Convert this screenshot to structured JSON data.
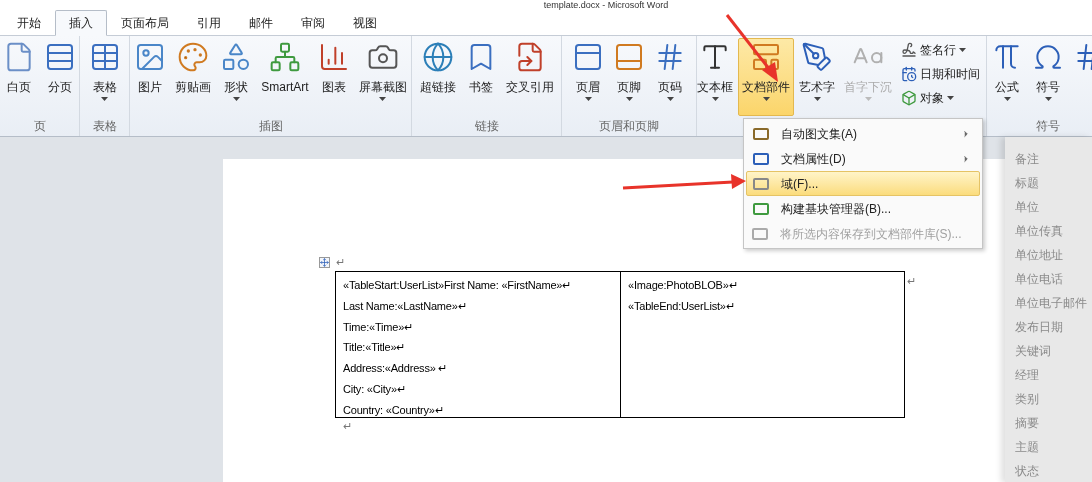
{
  "window": {
    "title": "template.docx - Microsoft Word"
  },
  "tabs": [
    {
      "label": "开始",
      "selected": false
    },
    {
      "label": "插入",
      "selected": true
    },
    {
      "label": "页面布局",
      "selected": false
    },
    {
      "label": "引用",
      "selected": false
    },
    {
      "label": "邮件",
      "selected": false
    },
    {
      "label": "审阅",
      "selected": false
    },
    {
      "label": "视图",
      "selected": false
    }
  ],
  "ribbon_groups": [
    {
      "label": "页",
      "items": [
        {
          "label": "白页",
          "kind": "large",
          "dropdown": false,
          "highlighted": false,
          "disabled": false
        },
        {
          "label": "分页",
          "kind": "large",
          "dropdown": false,
          "highlighted": false,
          "disabled": false
        }
      ]
    },
    {
      "label": "表格",
      "items": [
        {
          "label": "表格",
          "kind": "large",
          "dropdown": true,
          "highlighted": false,
          "disabled": false
        }
      ]
    },
    {
      "label": "插图",
      "items": [
        {
          "label": "图片",
          "kind": "large",
          "dropdown": false,
          "highlighted": false,
          "disabled": false
        },
        {
          "label": "剪贴画",
          "kind": "large",
          "dropdown": false,
          "highlighted": false,
          "disabled": false
        },
        {
          "label": "形状",
          "kind": "large",
          "dropdown": true,
          "highlighted": false,
          "disabled": false
        },
        {
          "label": "SmartArt",
          "kind": "large",
          "dropdown": false,
          "highlighted": false,
          "disabled": false
        },
        {
          "label": "图表",
          "kind": "large",
          "dropdown": false,
          "highlighted": false,
          "disabled": false
        },
        {
          "label": "屏幕截图",
          "kind": "large",
          "dropdown": true,
          "highlighted": false,
          "disabled": false
        }
      ]
    },
    {
      "label": "链接",
      "items": [
        {
          "label": "超链接",
          "kind": "large",
          "dropdown": false,
          "highlighted": false,
          "disabled": false
        },
        {
          "label": "书签",
          "kind": "large",
          "dropdown": false,
          "highlighted": false,
          "disabled": false
        },
        {
          "label": "交叉引用",
          "kind": "large",
          "dropdown": false,
          "highlighted": false,
          "disabled": false
        }
      ]
    },
    {
      "label": "页眉和页脚",
      "items": [
        {
          "label": "页眉",
          "kind": "large",
          "dropdown": true,
          "highlighted": false,
          "disabled": false
        },
        {
          "label": "页脚",
          "kind": "large",
          "dropdown": true,
          "highlighted": false,
          "disabled": false
        },
        {
          "label": "页码",
          "kind": "large",
          "dropdown": true,
          "highlighted": false,
          "disabled": false
        }
      ]
    },
    {
      "items": [
        {
          "label": "文本框",
          "kind": "large",
          "dropdown": true,
          "highlighted": false,
          "disabled": false
        },
        {
          "label": "文档部件",
          "kind": "large",
          "dropdown": true,
          "highlighted": true,
          "disabled": false
        },
        {
          "label": "艺术字",
          "kind": "large",
          "dropdown": true,
          "highlighted": false,
          "disabled": false
        },
        {
          "label": "首字下沉",
          "kind": "large",
          "dropdown": true,
          "highlighted": false,
          "disabled": true
        },
        {
          "label": "签名行",
          "kind": "small",
          "dropdown": true,
          "highlighted": false,
          "disabled": false
        },
        {
          "label": "日期和时间",
          "kind": "small",
          "dropdown": false,
          "highlighted": false,
          "disabled": false
        },
        {
          "label": "对象",
          "kind": "small",
          "dropdown": true,
          "highlighted": false,
          "disabled": false
        }
      ]
    },
    {
      "label": "符号",
      "items": [
        {
          "label": "公式",
          "kind": "large",
          "dropdown": true,
          "highlighted": false,
          "disabled": false
        },
        {
          "label": "符号",
          "kind": "large",
          "dropdown": true,
          "highlighted": false,
          "disabled": false
        },
        {
          "kind": "large",
          "dropdown": false,
          "highlighted": false,
          "disabled": false
        }
      ]
    }
  ],
  "menu": {
    "items": [
      {
        "label": "自动图文集(A)",
        "submenu": true,
        "selected": false,
        "disabled": false
      },
      {
        "label": "文档属性(D)",
        "submenu": true,
        "selected": false,
        "disabled": false
      },
      {
        "label": "域(F)...",
        "submenu": false,
        "selected": true,
        "disabled": false
      },
      {
        "label": "构建基块管理器(B)...",
        "submenu": false,
        "selected": false,
        "disabled": false
      },
      {
        "label": "将所选内容保存到文档部件库(S)...",
        "submenu": false,
        "selected": false,
        "disabled": true
      }
    ]
  },
  "document": {
    "before_mark": "↵",
    "row_end_mark": "↵",
    "after_mark": "↵",
    "cells": [
      {
        "lines": [
          "«TableStart:UserList»First Name: «FirstName»↵",
          "Last Name:«LastName»↵",
          "Time:«Time»↵",
          "Title:«Title»↵",
          "Address:«Address» ↵",
          "City: «City»↵",
          "Country: «Country»↵"
        ]
      },
      {
        "lines": [
          "«Image:PhotoBLOB»↵",
          "«TableEnd:UserList»↵"
        ]
      }
    ]
  },
  "property_list": [
    "备注",
    "标题",
    "单位",
    "单位传真",
    "单位地址",
    "单位电话",
    "单位电子邮件",
    "发布日期",
    "关键词",
    "经理",
    "类别",
    "摘要",
    "主题",
    "状态"
  ]
}
